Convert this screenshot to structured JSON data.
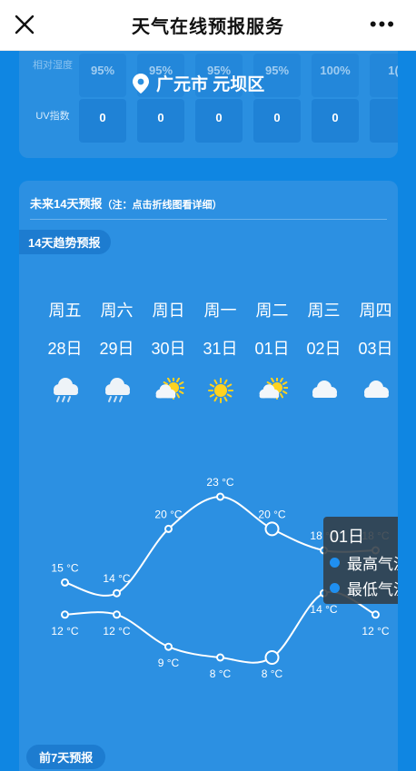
{
  "app": {
    "title": "天气在线预报服务"
  },
  "location": {
    "text": "广元市 元坝区"
  },
  "details": {
    "humidity_label": "相对湿度",
    "humidity_values": [
      "95%",
      "95%",
      "95%",
      "95%",
      "100%",
      "1("
    ],
    "uv_label": "UV指数",
    "uv_values": [
      "0",
      "0",
      "0",
      "0",
      "0",
      ""
    ]
  },
  "forecast": {
    "heading": "未来14天预报",
    "note": "（注：点击折线图看详细）",
    "trend_label": "14天趋势预报",
    "bottom_label": "前7天预报",
    "days": [
      {
        "weekday": "周五",
        "date": "28日",
        "icon": "cloud-rain-icon",
        "high": 15,
        "low": 12,
        "high_label": "15 °C",
        "low_label": "12 °C"
      },
      {
        "weekday": "周六",
        "date": "29日",
        "icon": "cloud-rain-icon",
        "high": 14,
        "low": 12,
        "high_label": "14 °C",
        "low_label": "12 °C"
      },
      {
        "weekday": "周日",
        "date": "30日",
        "icon": "sun-cloud-icon",
        "high": 20,
        "low": 9,
        "high_label": "20 °C",
        "low_label": "9 °C"
      },
      {
        "weekday": "周一",
        "date": "31日",
        "icon": "sun-icon",
        "high": 23,
        "low": 8,
        "high_label": "23 °C",
        "low_label": "8 °C"
      },
      {
        "weekday": "周二",
        "date": "01日",
        "icon": "sun-cloud-icon",
        "high": 20,
        "low": 8,
        "high_label": "20 °C",
        "low_label": "8 °C"
      },
      {
        "weekday": "周三",
        "date": "02日",
        "icon": "cloud-icon",
        "high": 18,
        "low": 14,
        "high_label": "18 °C",
        "low_label": "14 °C"
      },
      {
        "weekday": "周四",
        "date": "03日",
        "icon": "cloud-icon",
        "high": 18,
        "low": 12,
        "high_label": "18 °C",
        "low_label": "12 °C"
      }
    ],
    "tooltip": {
      "date": "01日",
      "high_item": "最高气温",
      "low_item": "最低气温"
    }
  },
  "colors": {
    "background": "#0f86e2",
    "card": "#2c90e2",
    "sun": "#ffd21f"
  }
}
